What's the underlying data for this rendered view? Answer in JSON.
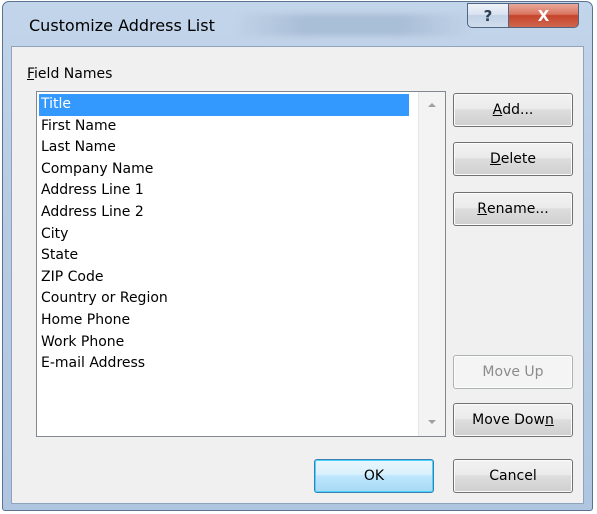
{
  "window": {
    "title": "Customize Address List",
    "help_label": "?",
    "close_label": "X"
  },
  "field_names": {
    "label_mnemonic": "F",
    "label_rest": "ield Names",
    "items": [
      "Title",
      "First Name",
      "Last Name",
      "Company Name",
      "Address Line 1",
      "Address Line 2",
      "City",
      "State",
      "ZIP Code",
      "Country or Region",
      "Home Phone",
      "Work Phone",
      "E-mail Address"
    ],
    "selected_index": 0
  },
  "buttons": {
    "add": {
      "mnemonic": "A",
      "rest": "dd..."
    },
    "delete": {
      "mnemonic": "D",
      "rest": "elete"
    },
    "rename": {
      "mnemonic": "R",
      "rest": "ename..."
    },
    "move_up": "Move Up",
    "move_down": {
      "pre": "Move Dow",
      "mnemonic": "n"
    },
    "ok": "OK",
    "cancel": "Cancel"
  }
}
